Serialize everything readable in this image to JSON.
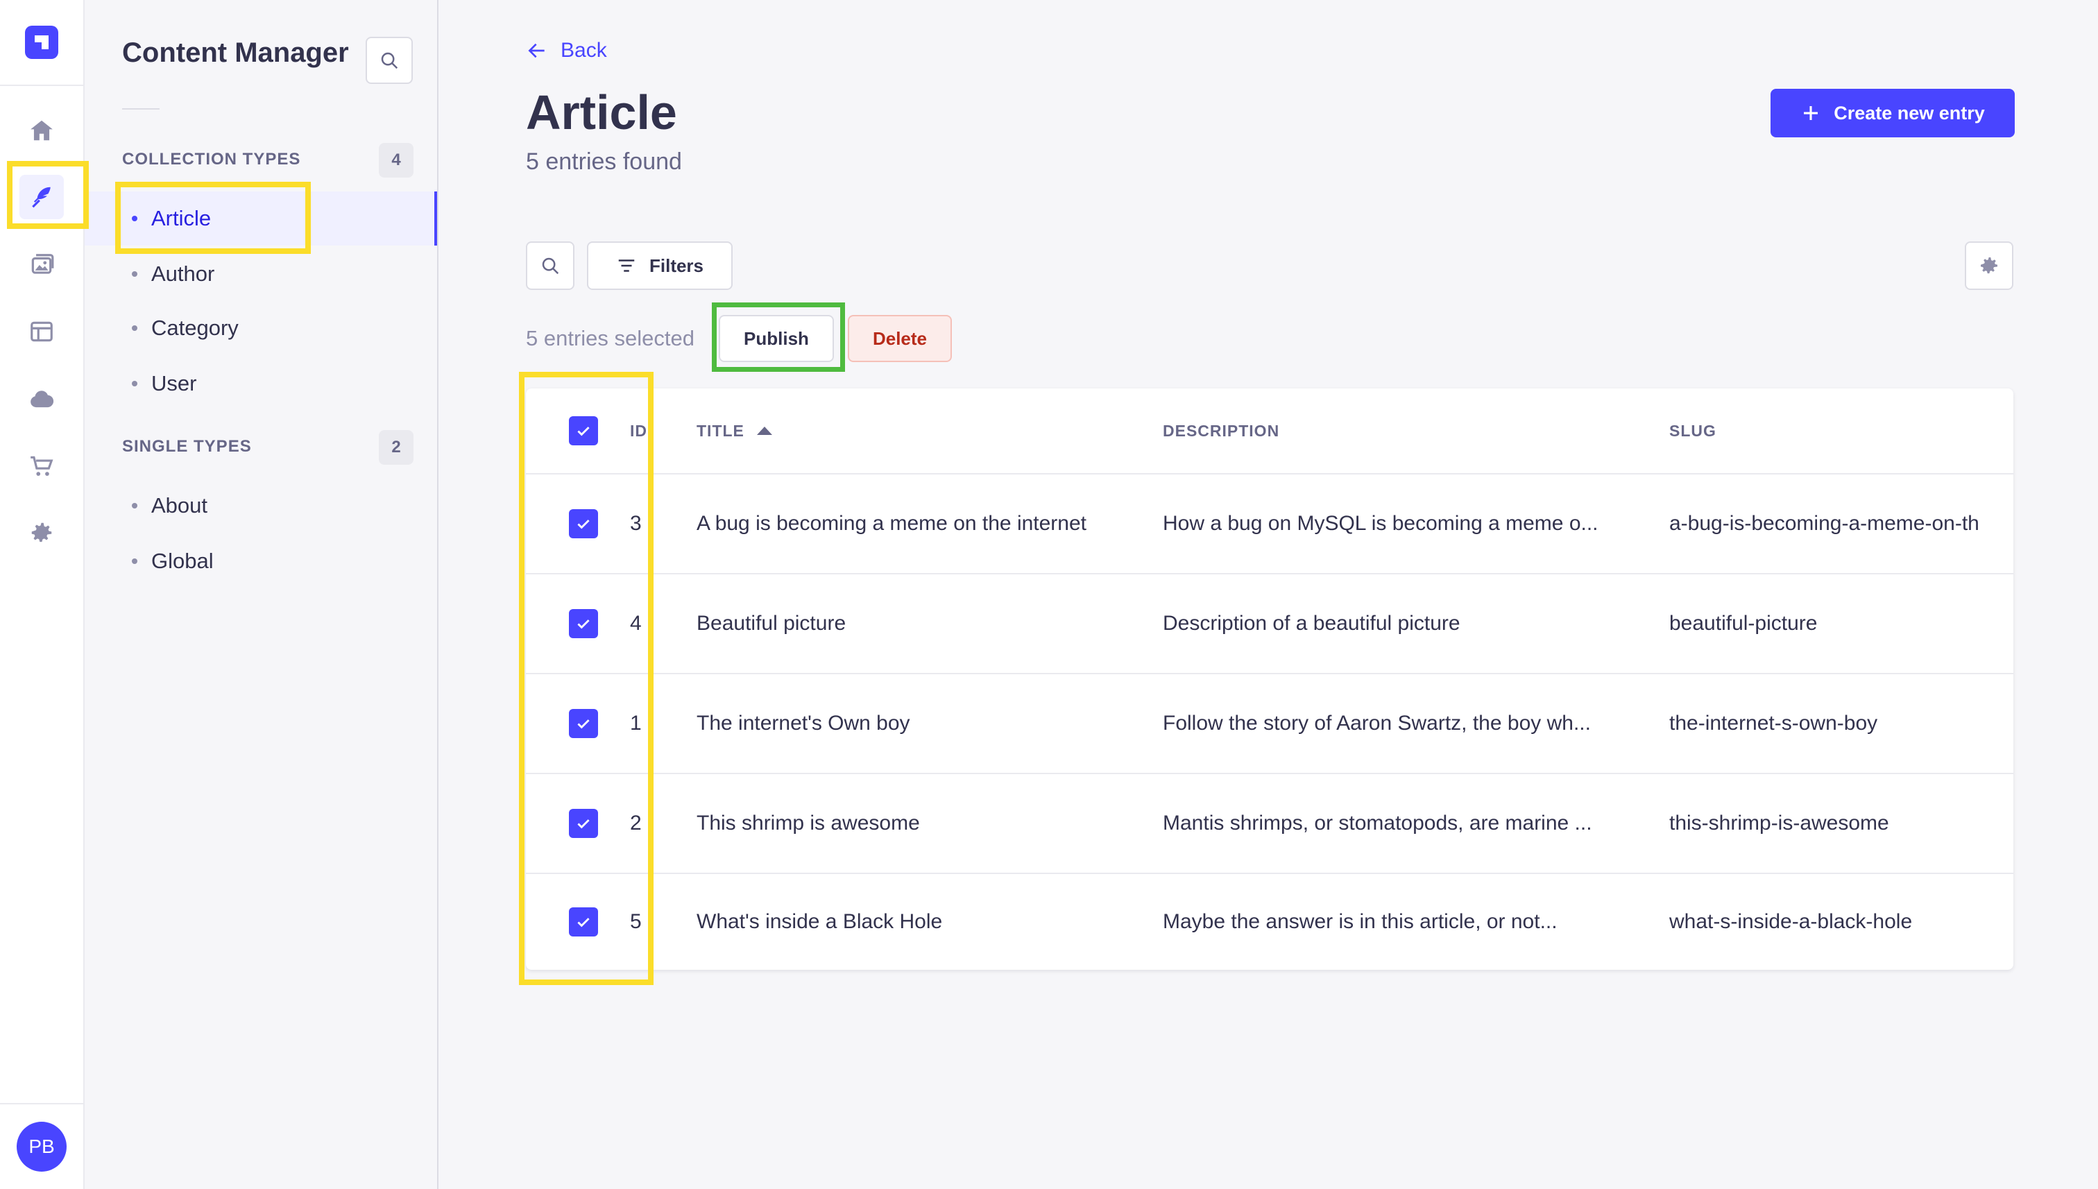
{
  "rail": {
    "items": [
      {
        "icon": "home-icon"
      },
      {
        "icon": "feather-icon"
      },
      {
        "icon": "media-library-icon"
      },
      {
        "icon": "layout-icon"
      },
      {
        "icon": "cloud-icon"
      },
      {
        "icon": "shopping-cart-icon"
      },
      {
        "icon": "gear-icon"
      }
    ],
    "avatar_initials": "PB"
  },
  "subnav": {
    "title": "Content Manager",
    "collection_section": {
      "label": "COLLECTION TYPES",
      "count": "4"
    },
    "collection_items": [
      "Article",
      "Author",
      "Category",
      "User"
    ],
    "single_section": {
      "label": "SINGLE TYPES",
      "count": "2"
    },
    "single_items": [
      "About",
      "Global"
    ]
  },
  "main": {
    "back_label": "Back",
    "title": "Article",
    "subtitle": "5 entries found",
    "create_label": "Create new entry",
    "filters_label": "Filters",
    "selected_text": "5 entries selected",
    "publish_label": "Publish",
    "delete_label": "Delete"
  },
  "table": {
    "headers": {
      "id": "ID",
      "title": "TITLE",
      "description": "DESCRIPTION",
      "slug": "SLUG"
    },
    "rows": [
      {
        "id": "3",
        "title": "A bug is becoming a meme on the internet",
        "description": "How a bug on MySQL is becoming a meme o...",
        "slug": "a-bug-is-becoming-a-meme-on-th"
      },
      {
        "id": "4",
        "title": "Beautiful picture",
        "description": "Description of a beautiful picture",
        "slug": "beautiful-picture"
      },
      {
        "id": "1",
        "title": "The internet's Own boy",
        "description": "Follow the story of Aaron Swartz, the boy wh...",
        "slug": "the-internet-s-own-boy"
      },
      {
        "id": "2",
        "title": "This shrimp is awesome",
        "description": "Mantis shrimps, or stomatopods, are marine ...",
        "slug": "this-shrimp-is-awesome"
      },
      {
        "id": "5",
        "title": "What's inside a Black Hole",
        "description": "Maybe the answer is in this article, or not...",
        "slug": "what-s-inside-a-black-hole"
      }
    ]
  },
  "colors": {
    "accent": "#4945ff",
    "highlight_yellow": "#fbdd2a",
    "highlight_green": "#4fbb3f",
    "danger": "#b72b1a"
  }
}
